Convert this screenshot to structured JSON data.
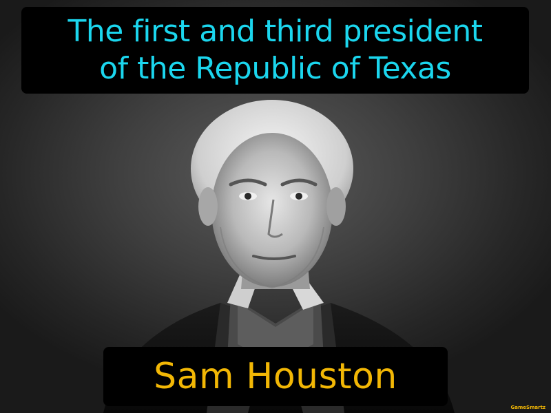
{
  "definition": {
    "line1": "The first and third president",
    "line2": "of the Republic of Texas"
  },
  "term": "Sam Houston",
  "brand": "GameSmartz",
  "colors": {
    "definition_text": "#1bd6ee",
    "term_text": "#f2b705",
    "box_background": "#000000"
  }
}
